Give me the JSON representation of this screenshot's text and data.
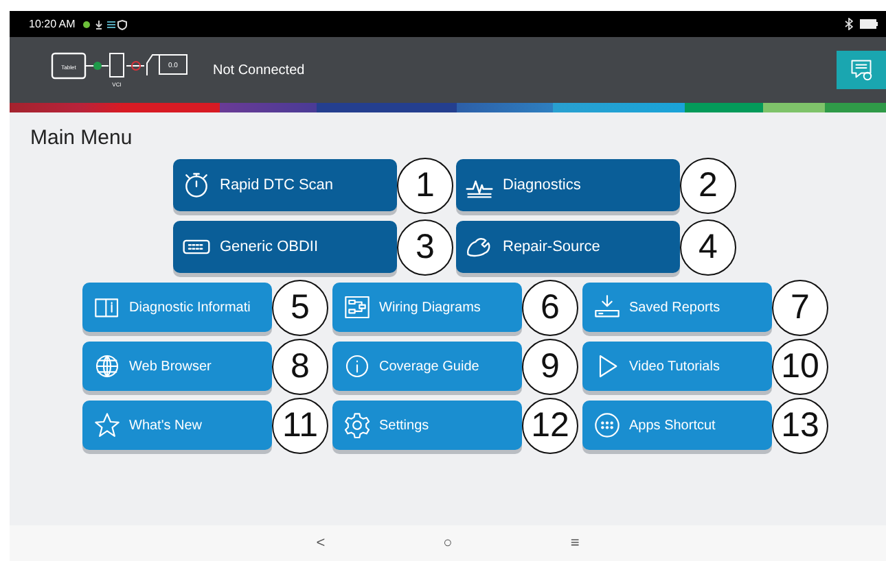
{
  "status_bar": {
    "time": "10:20 AM"
  },
  "header": {
    "diagram": {
      "tablet_label": "Tablet",
      "vci_label": "VCI",
      "battery_reading": "0.0"
    },
    "connection_status": "Not Connected"
  },
  "title": "Main Menu",
  "large_buttons": [
    {
      "label": "Rapid DTC Scan",
      "callout": "1"
    },
    {
      "label": "Diagnostics",
      "callout": "2"
    },
    {
      "label": "Generic OBDII",
      "callout": "3"
    },
    {
      "label": "Repair-Source",
      "callout": "4"
    }
  ],
  "small_buttons": [
    {
      "label": "Diagnostic Informati",
      "callout": "5"
    },
    {
      "label": "Wiring Diagrams",
      "callout": "6"
    },
    {
      "label": "Saved Reports",
      "callout": "7"
    },
    {
      "label": "Web Browser",
      "callout": "8"
    },
    {
      "label": "Coverage Guide",
      "callout": "9"
    },
    {
      "label": "Video Tutorials",
      "callout": "10"
    },
    {
      "label": "What's New",
      "callout": "11"
    },
    {
      "label": "Settings",
      "callout": "12"
    },
    {
      "label": "Apps Shortcut",
      "callout": "13"
    }
  ],
  "nav_bar": [
    "<",
    "○",
    "≡"
  ]
}
